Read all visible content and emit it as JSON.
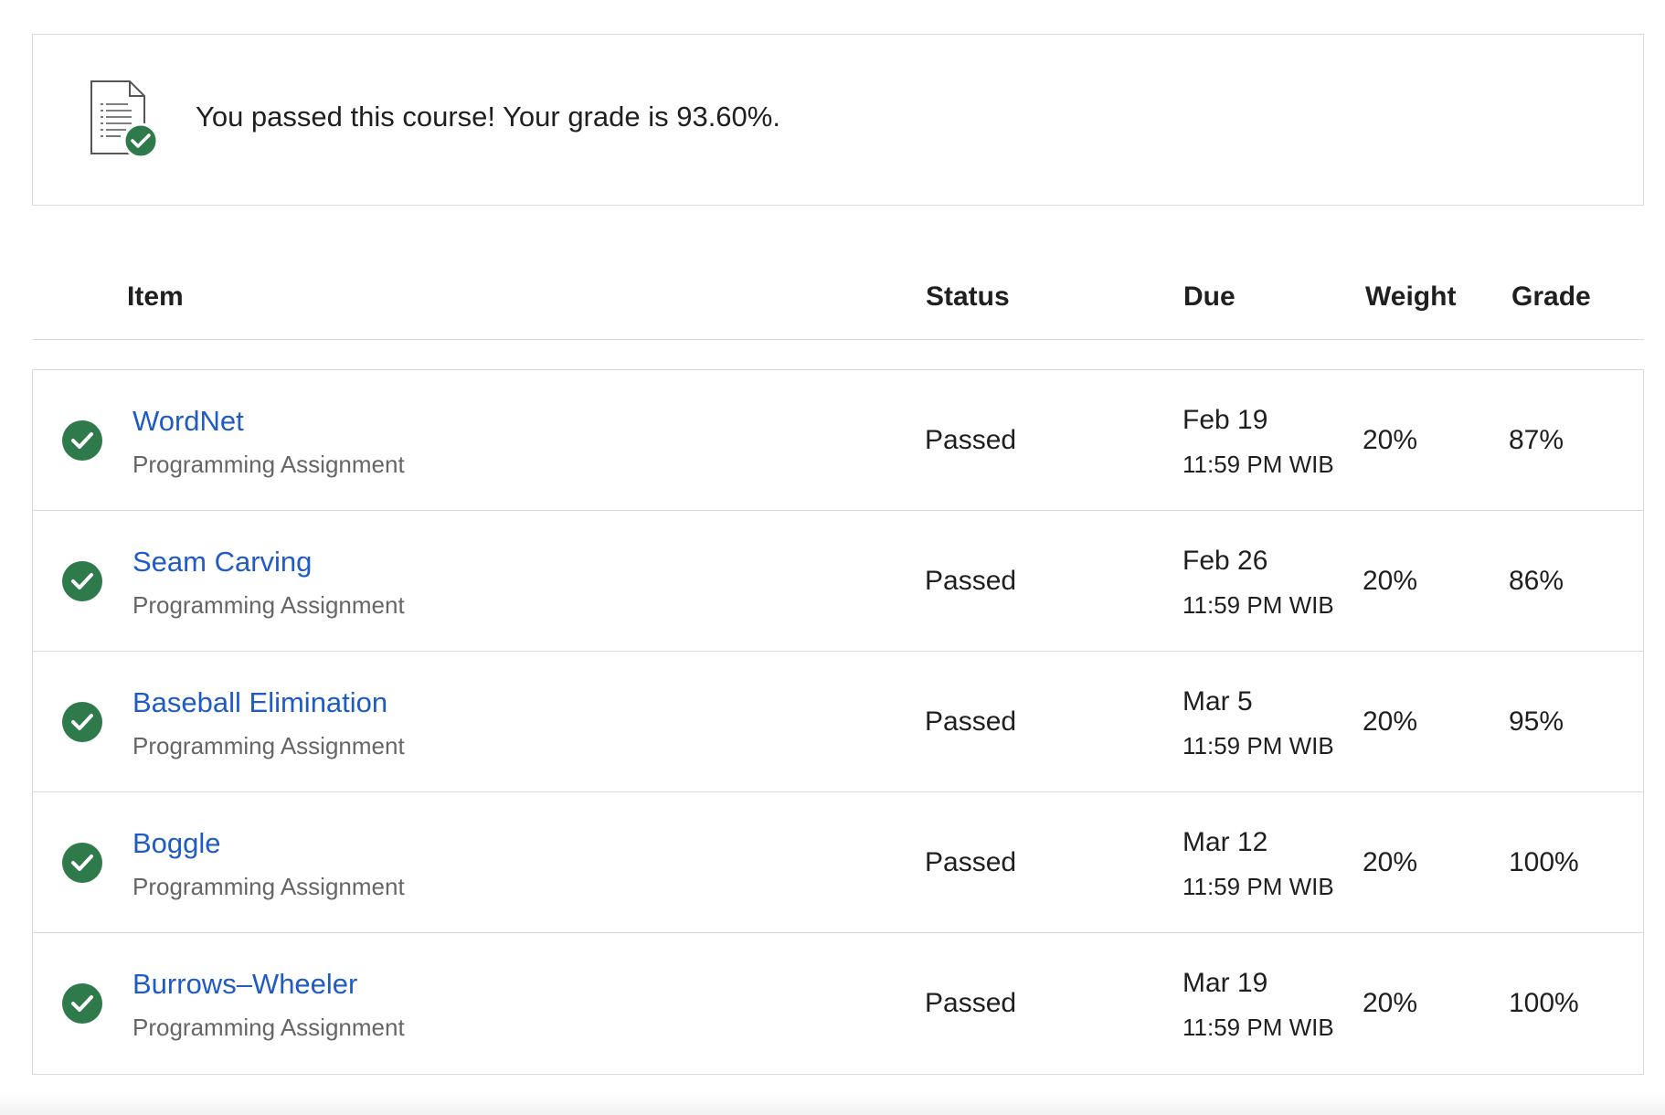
{
  "banner": {
    "icon": "document-check-icon",
    "message": "You passed this course! Your grade is 93.60%."
  },
  "table": {
    "headers": {
      "item": "Item",
      "status": "Status",
      "due": "Due",
      "weight": "Weight",
      "grade": "Grade"
    },
    "rows": [
      {
        "title": "WordNet",
        "type": "Programming Assignment",
        "status": "Passed",
        "due_date": "Feb 19",
        "due_time": "11:59 PM WIB",
        "weight": "20%",
        "grade": "87%"
      },
      {
        "title": "Seam Carving",
        "type": "Programming Assignment",
        "status": "Passed",
        "due_date": "Feb 26",
        "due_time": "11:59 PM WIB",
        "weight": "20%",
        "grade": "86%"
      },
      {
        "title": "Baseball Elimination",
        "type": "Programming Assignment",
        "status": "Passed",
        "due_date": "Mar 5",
        "due_time": "11:59 PM WIB",
        "weight": "20%",
        "grade": "95%"
      },
      {
        "title": "Boggle",
        "type": "Programming Assignment",
        "status": "Passed",
        "due_date": "Mar 12",
        "due_time": "11:59 PM WIB",
        "weight": "20%",
        "grade": "100%"
      },
      {
        "title": "Burrows–Wheeler",
        "type": "Programming Assignment",
        "status": "Passed",
        "due_date": "Mar 19",
        "due_time": "11:59 PM WIB",
        "weight": "20%",
        "grade": "100%"
      }
    ]
  },
  "colors": {
    "link": "#1e5bc6",
    "success": "#2f7a4a",
    "border": "#dadada",
    "muted_text": "#666666"
  }
}
